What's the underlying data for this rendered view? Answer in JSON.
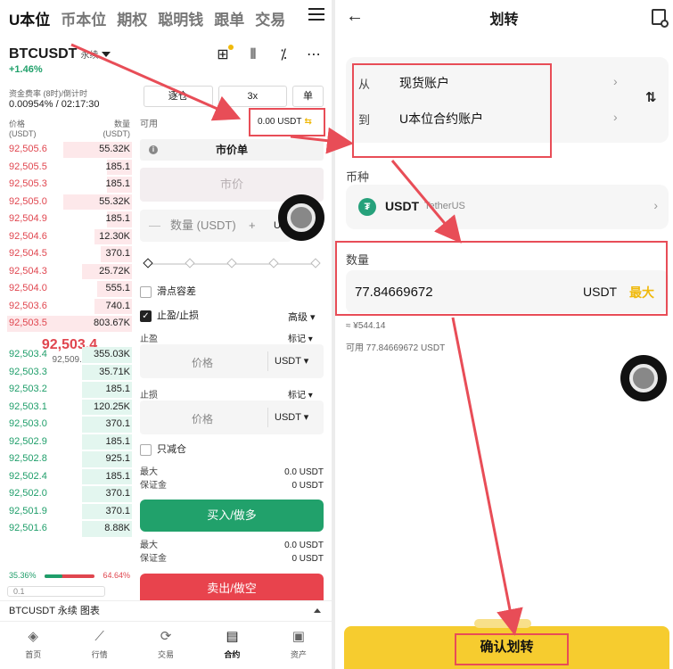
{
  "left": {
    "tabs": [
      "U本位",
      "币本位",
      "期权",
      "聪明钱",
      "跟单",
      "交易"
    ],
    "active_tab": "U本位",
    "symbol": "BTCUSDT",
    "symbol_type": "永续",
    "change": "+1.46%",
    "funding_label": "资金费率 (8时)/倒计时",
    "funding_value": "0.00954% / 02:17:30",
    "ob_price_header": "价格",
    "ob_price_unit": "(USDT)",
    "ob_qty_header": "数量",
    "ob_qty_unit": "(USDT)",
    "asks": [
      {
        "price": "92,505.6",
        "qty": "55.32K",
        "depth": 0.55
      },
      {
        "price": "92,505.5",
        "qty": "185.1",
        "depth": 0.2
      },
      {
        "price": "92,505.3",
        "qty": "185.1",
        "depth": 0.2
      },
      {
        "price": "92,505.0",
        "qty": "55.32K",
        "depth": 0.55
      },
      {
        "price": "92,504.9",
        "qty": "185.1",
        "depth": 0.2
      },
      {
        "price": "92,504.6",
        "qty": "12.30K",
        "depth": 0.3
      },
      {
        "price": "92,504.5",
        "qty": "370.1",
        "depth": 0.25
      },
      {
        "price": "92,504.3",
        "qty": "25.72K",
        "depth": 0.4
      },
      {
        "price": "92,504.0",
        "qty": "555.1",
        "depth": 0.28
      },
      {
        "price": "92,503.6",
        "qty": "740.1",
        "depth": 0.3
      },
      {
        "price": "92,503.5",
        "qty": "803.67K",
        "depth": 1.0
      }
    ],
    "last_price": "92,503.4",
    "mark_price": "92,509.9",
    "bids": [
      {
        "price": "92,503.4",
        "qty": "355.03K",
        "depth": 0.4
      },
      {
        "price": "92,503.3",
        "qty": "35.71K",
        "depth": 0.4
      },
      {
        "price": "92,503.2",
        "qty": "185.1",
        "depth": 0.4
      },
      {
        "price": "92,503.1",
        "qty": "120.25K",
        "depth": 0.4
      },
      {
        "price": "92,503.0",
        "qty": "370.1",
        "depth": 0.4
      },
      {
        "price": "92,502.9",
        "qty": "185.1",
        "depth": 0.4
      },
      {
        "price": "92,502.8",
        "qty": "925.1",
        "depth": 0.4
      },
      {
        "price": "92,502.4",
        "qty": "185.1",
        "depth": 0.4
      },
      {
        "price": "92,502.0",
        "qty": "370.1",
        "depth": 0.4
      },
      {
        "price": "92,501.9",
        "qty": "370.1",
        "depth": 0.4
      },
      {
        "price": "92,501.6",
        "qty": "8.88K",
        "depth": 0.4
      }
    ],
    "buy_ratio": "35.36%",
    "sell_ratio": "64.64%",
    "depth_select": "0.1",
    "margin_mode": "逐仓",
    "leverage": "3x",
    "position_mode": "单",
    "available_label": "可用",
    "available_value": "0.00 USDT",
    "order_type": "市价单",
    "market_price_placeholder": "市价",
    "qty_placeholder": "数量 (USDT)",
    "qty_unit": "U",
    "slippage_label": "滑点容差",
    "tpsl_label": "止盈/止损",
    "advanced_label": "高级",
    "tp_label": "止盈",
    "sl_label": "止损",
    "mark_label": "标记",
    "price_placeholder": "价格",
    "price_unit": "USDT",
    "reduce_only_label": "只减仓",
    "max_label": "最大",
    "margin_label": "保证金",
    "buy_max": "0.0 USDT",
    "buy_margin": "0 USDT",
    "buy_button": "买入/做多",
    "sell_max": "0.0 USDT",
    "sell_margin": "0 USDT",
    "sell_button": "卖出/做空",
    "bottom_bar": "BTCUSDT 永续  图表",
    "nav": [
      "首页",
      "行情",
      "交易",
      "合约",
      "资产"
    ],
    "nav_active": "合约"
  },
  "right": {
    "title": "划转",
    "from_label": "从",
    "from_value": "现货账户",
    "to_label": "到",
    "to_value": "U本位合约账户",
    "coin_label": "币种",
    "coin": "USDT",
    "coin_full": "TetherUS",
    "amount_label": "数量",
    "amount": "77.84669672",
    "amount_unit": "USDT",
    "max_button": "最大",
    "approx": "≈ ¥544.14",
    "available": "可用 77.84669672 USDT",
    "confirm_button": "确认划转"
  },
  "colors": {
    "accent": "#f0b90b",
    "buy": "#21a16b",
    "sell": "#e8434d",
    "highlight": "#e84d57"
  }
}
